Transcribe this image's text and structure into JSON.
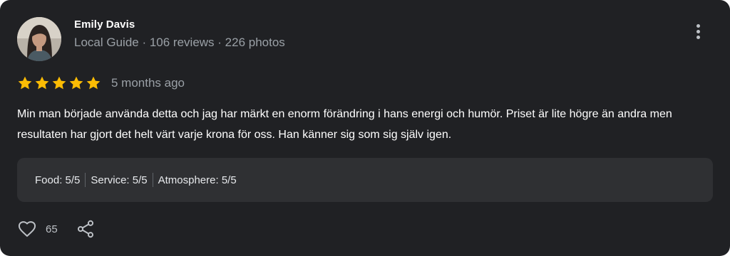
{
  "reviewer": {
    "name": "Emily Davis",
    "meta": "Local Guide · 106 reviews · 226 photos",
    "avatar": "avatar-photo"
  },
  "rating": {
    "stars": 5,
    "max": 5,
    "color": "#fbbc04",
    "time": "5 months ago"
  },
  "review": {
    "text": "Min man började använda detta och jag har märkt en enorm förändring i hans energi och humör. Priset är lite högre än andra men resultaten har gjort det helt värt varje krona för oss. Han känner sig som sig själv igen."
  },
  "subratings": [
    {
      "label": "Food: 5/5"
    },
    {
      "label": "Service: 5/5"
    },
    {
      "label": "Atmosphere: 5/5"
    }
  ],
  "actions": {
    "like_icon": "heart-icon",
    "like_count": "65",
    "share_icon": "share-icon",
    "more_icon": "more-vert-icon"
  },
  "colors": {
    "card_background": "#202124",
    "subrating_background": "#2f3033",
    "muted_text": "#9aa0a6"
  }
}
